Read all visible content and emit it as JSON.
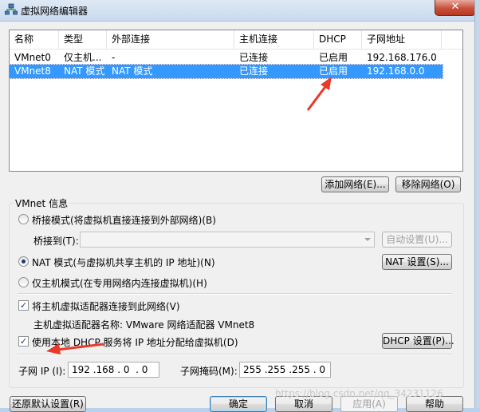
{
  "window": {
    "title": "虚拟网络编辑器",
    "close_label": "✕"
  },
  "table": {
    "headers": [
      "名称",
      "类型",
      "外部连接",
      "主机连接",
      "DHCP",
      "子网地址"
    ],
    "rows": [
      [
        "VMnet0",
        "仅主机...",
        "-",
        "已连接",
        "已启用",
        "192.168.176.0"
      ],
      [
        "VMnet8",
        "NAT 模式",
        "NAT 模式",
        "已连接",
        "已启用",
        "192.168.0.0"
      ]
    ],
    "selected_row": 1
  },
  "buttons": {
    "add_network": "添加网络(E)...",
    "remove_network": "移除网络(O)",
    "auto_settings": "自动设置(U)...",
    "nat_settings": "NAT 设置(S)...",
    "dhcp_settings": "DHCP 设置(P)...",
    "restore_defaults": "还原默认设置(R)",
    "ok": "确定",
    "cancel": "取消",
    "apply": "应用(A)",
    "help": "帮助"
  },
  "vmnet_info": {
    "group_label": "VMnet 信息",
    "bridged_label": "桥接模式(将虚拟机直接连接到外部网络)(B)",
    "bridged_to_label": "桥接到(T):",
    "bridged_to_value": "",
    "nat_label": "NAT 模式(与虚拟机共享主机的 IP 地址)(N)",
    "hostonly_label": "仅主机模式(在专用网络内连接虚拟机)(H)",
    "selected_mode": "nat",
    "connect_adapter_label": "将主机虚拟适配器连接到此网络(V)",
    "connect_adapter_checked": true,
    "adapter_name_label": "主机虚拟适配器名称: VMware 网络适配器 VMnet8",
    "use_dhcp_label": "使用本地 DHCP 服务将 IP 地址分配给虚拟机(D)",
    "use_dhcp_checked": true,
    "subnet_ip_label": "子网 IP (I):",
    "subnet_ip_value": "192 .168 . 0  . 0",
    "subnet_mask_label": "子网掩码(M):",
    "subnet_mask_value": "255 .255 .255 . 0"
  },
  "watermark": "https://blog.csdn.net/qq_34231126",
  "colors": {
    "selection": "#3399ff",
    "annotation_arrow": "#e8392a"
  }
}
